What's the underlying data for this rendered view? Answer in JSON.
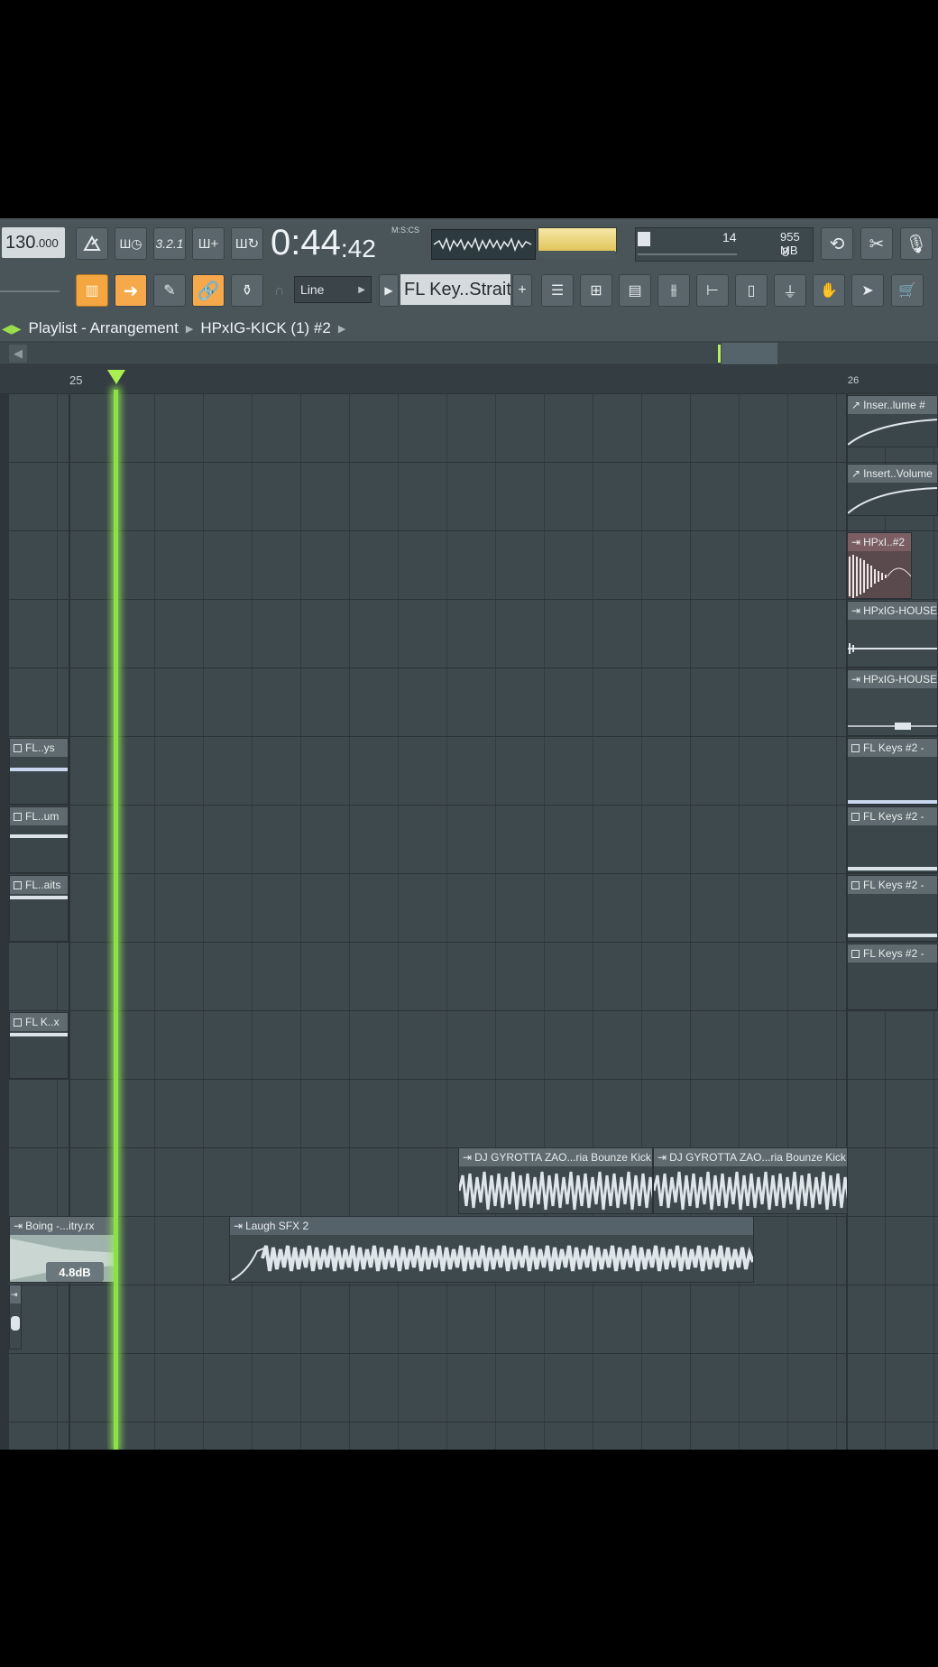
{
  "toolbar": {
    "tempo_main": "130",
    "tempo_frac": ".000",
    "time_main": "0:44",
    "time_cs": ":42",
    "time_label": "M:S:CS",
    "cpu_value": "14",
    "memory": "955 MB",
    "polyphony": "8",
    "snap_mode": "Line",
    "pattern_name": "FL Key..Straits",
    "add_label": "+"
  },
  "breadcrumb": {
    "root": "Playlist - Arrangement",
    "item": "HPxIG-KICK (1) #2"
  },
  "ruler": {
    "bar_25": "25",
    "bar_26": "26"
  },
  "clips": {
    "inser_lume": "Inser..lume #",
    "insert_volume": "Insert..Volume",
    "hpxi_2": "HPxI..#2",
    "hpxig_hous_1": "HPxIG-HOUSE",
    "hpxig_hous_2": "HPxIG-HOUSE",
    "fl_keys_1": "FL Keys #2 -",
    "fl_keys_2": "FL Keys #2 -",
    "fl_keys_3": "FL Keys #2 -",
    "fl_keys_4": "FL Keys #2 -",
    "fl_ys": "FL..ys",
    "fl_um": "FL..um",
    "fl_aits": "FL..aits",
    "fl_kx": "FL K..x",
    "dj_kick_1": "DJ GYROTTA ZAO...ria Bounze Kick",
    "dj_kick_2": "DJ GYROTTA ZAO...ria Bounze Kick",
    "boing": "Boing -...itry.rx",
    "boing_gain": "4.8dB",
    "laugh": "Laugh SFX 2"
  },
  "colors": {
    "playhead": "#8ee04a",
    "accent_orange": "#f4a640",
    "grid_bg": "#3e494e"
  }
}
